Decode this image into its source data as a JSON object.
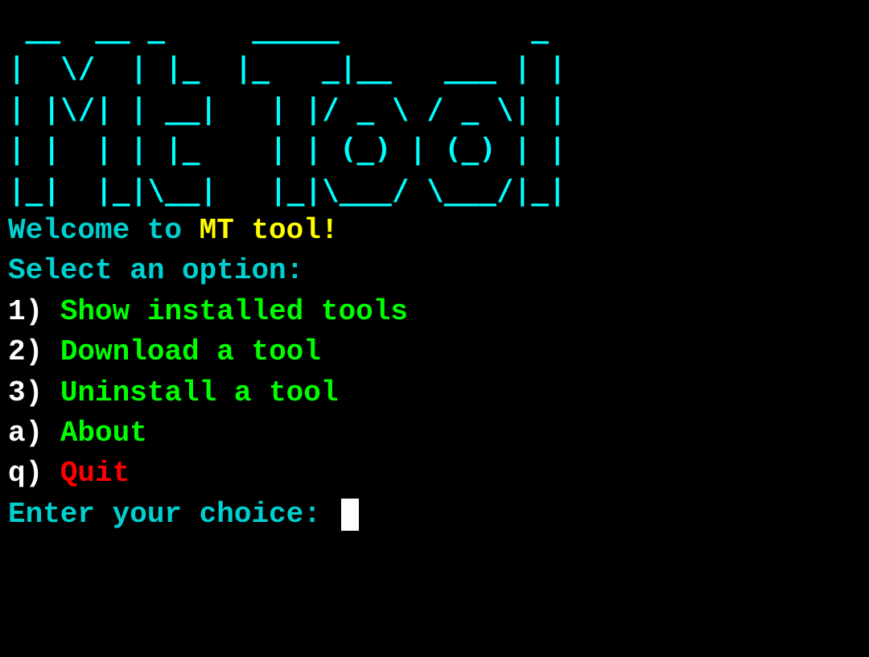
{
  "ascii_art": " __  __ _     _____           _ \n|  \\/  | |_  |_   _|__   ___ | |\n| |\\/| | __|   | |/ _ \\ / _ \\| |\n| |  | | |_    | | (_) | (_) | |\n|_|  |_|\\__|   |_|\\___/ \\___/|_|",
  "welcome": {
    "prefix": "Welcome to ",
    "highlight": "MT tool!"
  },
  "select_prompt": "Select an option:",
  "menu": [
    {
      "key": "1)",
      "label": "Show installed tools",
      "color": "green"
    },
    {
      "key": "2)",
      "label": "Download a tool",
      "color": "green"
    },
    {
      "key": "3)",
      "label": "Uninstall a tool",
      "color": "green"
    },
    {
      "key": "a)",
      "label": "About",
      "color": "green"
    },
    {
      "key": "q)",
      "label": "Quit",
      "color": "red"
    }
  ],
  "input_prompt": "Enter your choice: "
}
